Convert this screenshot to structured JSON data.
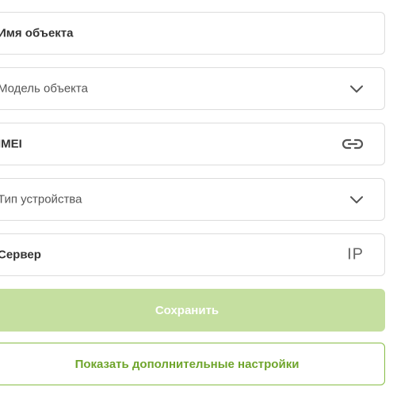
{
  "form": {
    "fields": [
      {
        "label": "Имя объекта",
        "icon": ""
      },
      {
        "label": "Модель объекта",
        "icon": "chevron-down-icon"
      },
      {
        "label": "IMEI",
        "icon": "link-icon"
      },
      {
        "label": "Тип устройства",
        "icon": "chevron-down-icon"
      },
      {
        "label": "Сервер",
        "icon": "ip-icon",
        "icon_text": "IP"
      }
    ],
    "save_label": "Сохранить",
    "more_settings_label": "Показать дополнительные настройки"
  },
  "colors": {
    "save_button_bg": "#c5dfa0",
    "more_button_border": "#86bd45",
    "more_button_text": "#6fa52c",
    "field_border": "#dcdcdc"
  }
}
